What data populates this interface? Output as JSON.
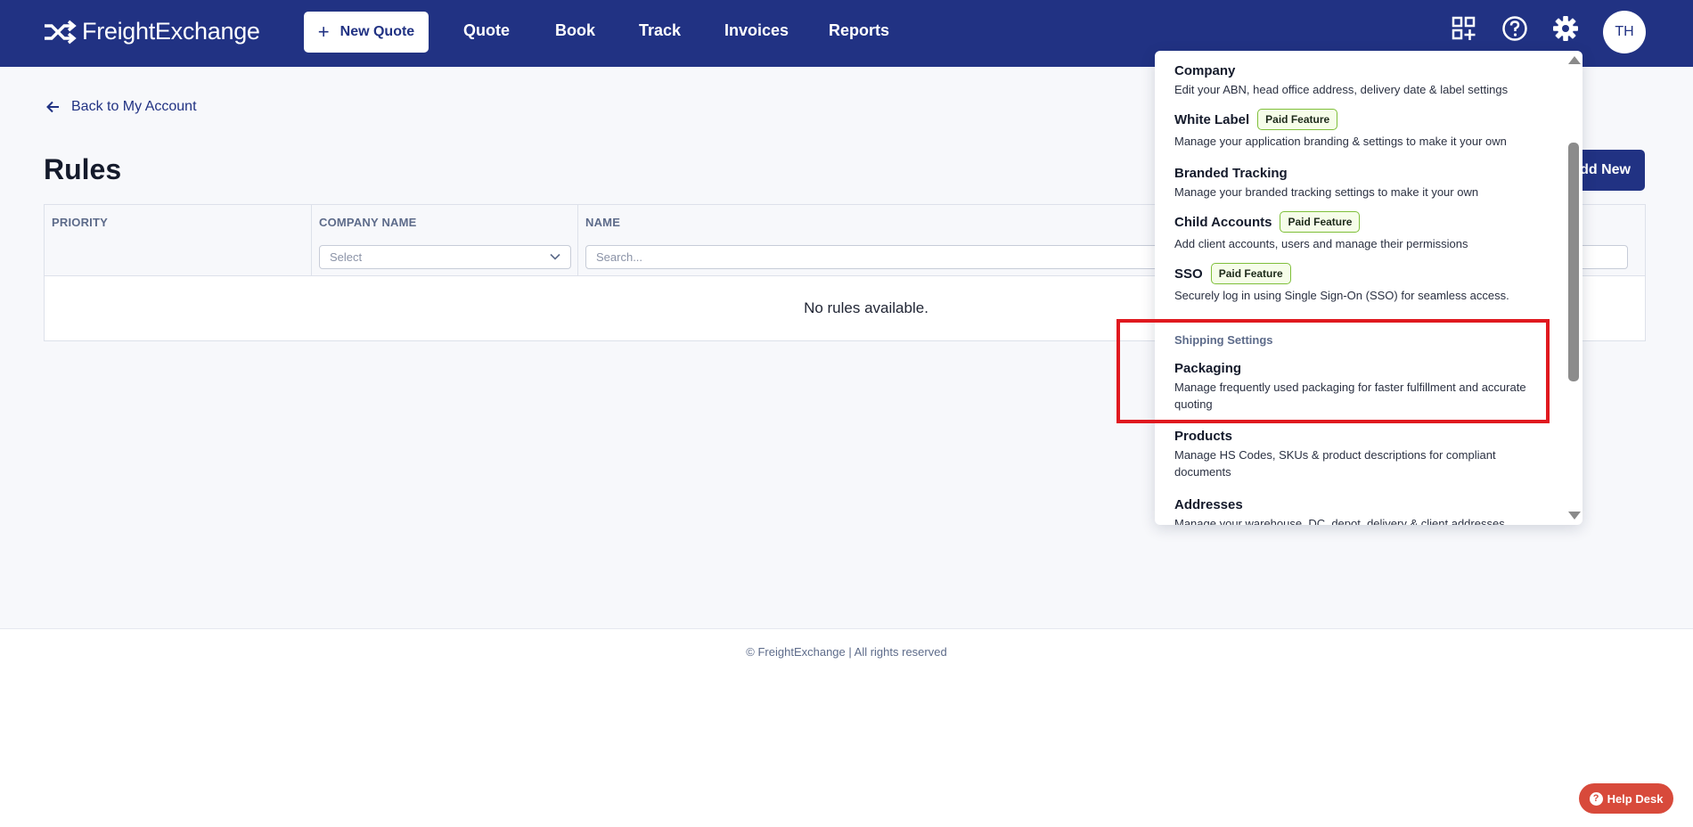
{
  "header": {
    "brand": "FreightExchange",
    "new_quote_label": "New Quote",
    "nav": [
      "Quote",
      "Book",
      "Track",
      "Invoices",
      "Reports"
    ],
    "avatar_initials": "TH",
    "bg_color": "#213283"
  },
  "main": {
    "back_link": "Back to My Account",
    "title": "Rules",
    "add_new_label": "Add New",
    "table": {
      "columns": [
        "PRIORITY",
        "COMPANY NAME",
        "NAME"
      ],
      "company_select_placeholder": "Select",
      "name_search_placeholder": "Search...",
      "empty_message": "No rules available."
    }
  },
  "footer": {
    "copyright": "© FreightExchange | All rights reserved"
  },
  "help_desk": {
    "label": "Help Desk",
    "color": "#d84a3b"
  },
  "settings_menu": {
    "items": [
      {
        "title": "Company",
        "desc": "Edit your ABN, head office address, delivery date & label settings",
        "badge": ""
      },
      {
        "title": "White Label",
        "desc": "Manage your application branding & settings to make it your own",
        "badge": "Paid Feature"
      },
      {
        "title": "Branded Tracking",
        "desc": "Manage your branded tracking settings to make it your own",
        "badge": ""
      },
      {
        "title": "Child Accounts",
        "desc": "Add client accounts, users and manage their permissions",
        "badge": "Paid Feature"
      },
      {
        "title": "SSO",
        "desc": "Securely log in using Single Sign-On (SSO) for seamless access.",
        "badge": "Paid Feature"
      }
    ],
    "section_label": "Shipping Settings",
    "shipping_items": [
      {
        "title": "Packaging",
        "desc": "Manage frequently used packaging for faster fulfillment and accurate quoting"
      },
      {
        "title": "Products",
        "desc": "Manage HS Codes, SKUs & product descriptions for compliant documents"
      },
      {
        "title": "Addresses",
        "desc": "Manage your warehouse, DC, depot, delivery & client addresses"
      }
    ],
    "highlight_color": "#e0191f"
  }
}
